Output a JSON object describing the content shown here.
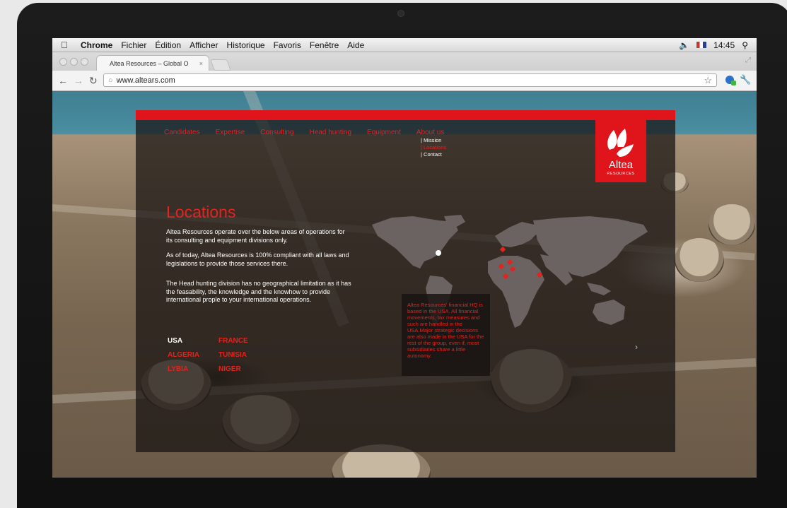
{
  "menubar": {
    "apple_icon": "apple-icon",
    "items": [
      "Chrome",
      "Fichier",
      "Édition",
      "Afficher",
      "Historique",
      "Favoris",
      "Fenêtre",
      "Aide"
    ],
    "clock": "14:45"
  },
  "browser": {
    "tab_title": "Altea Resources – Global O",
    "tab_close": "×",
    "url": "www.altears.com"
  },
  "site": {
    "colors": {
      "accent": "#e0141b",
      "text": "#ffffff",
      "panel": "#161211"
    },
    "nav": [
      "Candidates",
      "Expertise",
      "Consulting",
      "Head hunting",
      "Equipment",
      "About us"
    ],
    "submenu": [
      "| Mission",
      "| Locations",
      "| Contact"
    ],
    "logo": {
      "name": "Altea",
      "sub": "RESOURCES"
    },
    "page_title": "Locations",
    "paragraphs": [
      "Altea Resources operate over the below areas of operations for its consulting and equipment divisions only.",
      "As of today, Altea Resources is 100% compliant with all laws and legislations to provide those services there.",
      "The Head hunting division has no  geographical limitation as it  has the feasability, the knowledge and the knowhow to provide international prople to your international operations."
    ],
    "countries": [
      "USA",
      "FRANCE",
      "ALGERIA",
      "TUNISIA",
      "LYBIA",
      "NIGER"
    ],
    "popup": "Altea Resources' financial HQ is based in the USA. All financial movements, tax measures and such are handled in the USA.Major strategic decisions are also made in the USA for the rest of the group, even if, most subsidiaries share a little autonomy."
  }
}
